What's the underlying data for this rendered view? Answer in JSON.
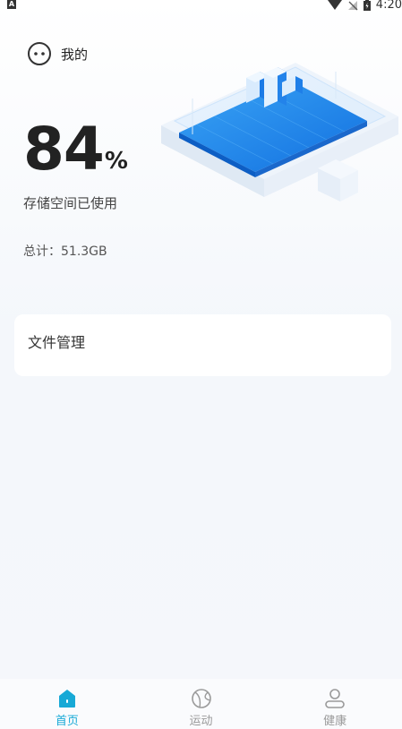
{
  "status": {
    "time": "4:20",
    "left_badge": "A"
  },
  "header": {
    "title": "我的",
    "icon": "face-icon"
  },
  "storage": {
    "percent_value": "84",
    "percent_unit": "%",
    "caption": "存储空间已使用",
    "total_label": "总计：51.3GB"
  },
  "card": {
    "title": "文件管理"
  },
  "tabs": [
    {
      "label": "首页",
      "icon": "home-icon",
      "active": true
    },
    {
      "label": "运动",
      "icon": "ball-icon",
      "active": false
    },
    {
      "label": "健康",
      "icon": "person-icon",
      "active": false
    }
  ],
  "colors": {
    "accent": "#17a9d6",
    "inactive": "#9a9a9a",
    "illustration_blue": "#1e8ff0"
  }
}
